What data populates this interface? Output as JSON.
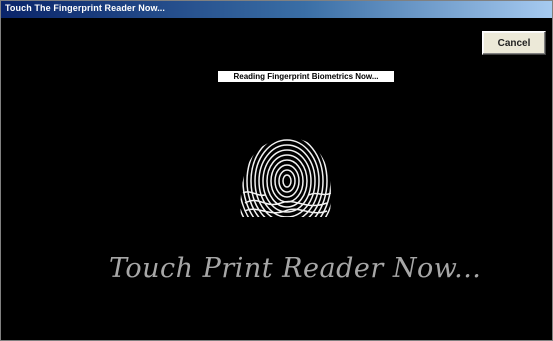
{
  "window": {
    "title": "Touch The Fingerprint Reader Now...",
    "cancel_label": "Cancel",
    "status_label": "Reading Fingerprint Biometrics Now...",
    "prompt_text": "Touch Print Reader Now...",
    "icons": {
      "fingerprint": "fingerprint-icon"
    },
    "colors": {
      "background": "#000000",
      "titlebar_start": "#0a246a",
      "titlebar_end": "#a6caf0",
      "prompt_text": "#a7a7a7"
    }
  }
}
